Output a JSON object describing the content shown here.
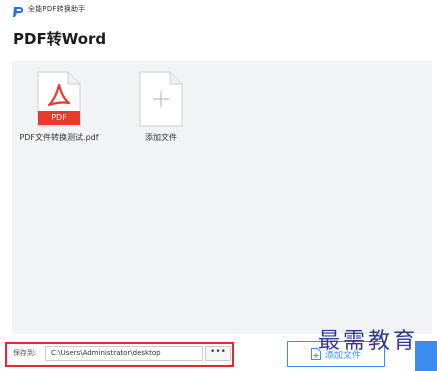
{
  "app": {
    "name": "全能PDF转换助手",
    "accent_color": "#3d8cf0",
    "logo_icon": "app-logo-icon"
  },
  "page": {
    "title": "PDF转Word"
  },
  "files": {
    "items": [
      {
        "name": "PDF文件转换测试.pdf",
        "badge": "PDF",
        "icon": "pdf-file-icon",
        "badge_color": "#e8392b"
      },
      {
        "name": "添加文件",
        "icon": "add-file-icon"
      }
    ]
  },
  "save": {
    "label": "保存到:",
    "path": "C:\\Users\\Administrator\\desktop",
    "browse_label": "•••",
    "highlight_color": "#e8292c"
  },
  "actions": {
    "add_file_label": "添加文件"
  },
  "watermark": {
    "text": "最需教育"
  }
}
